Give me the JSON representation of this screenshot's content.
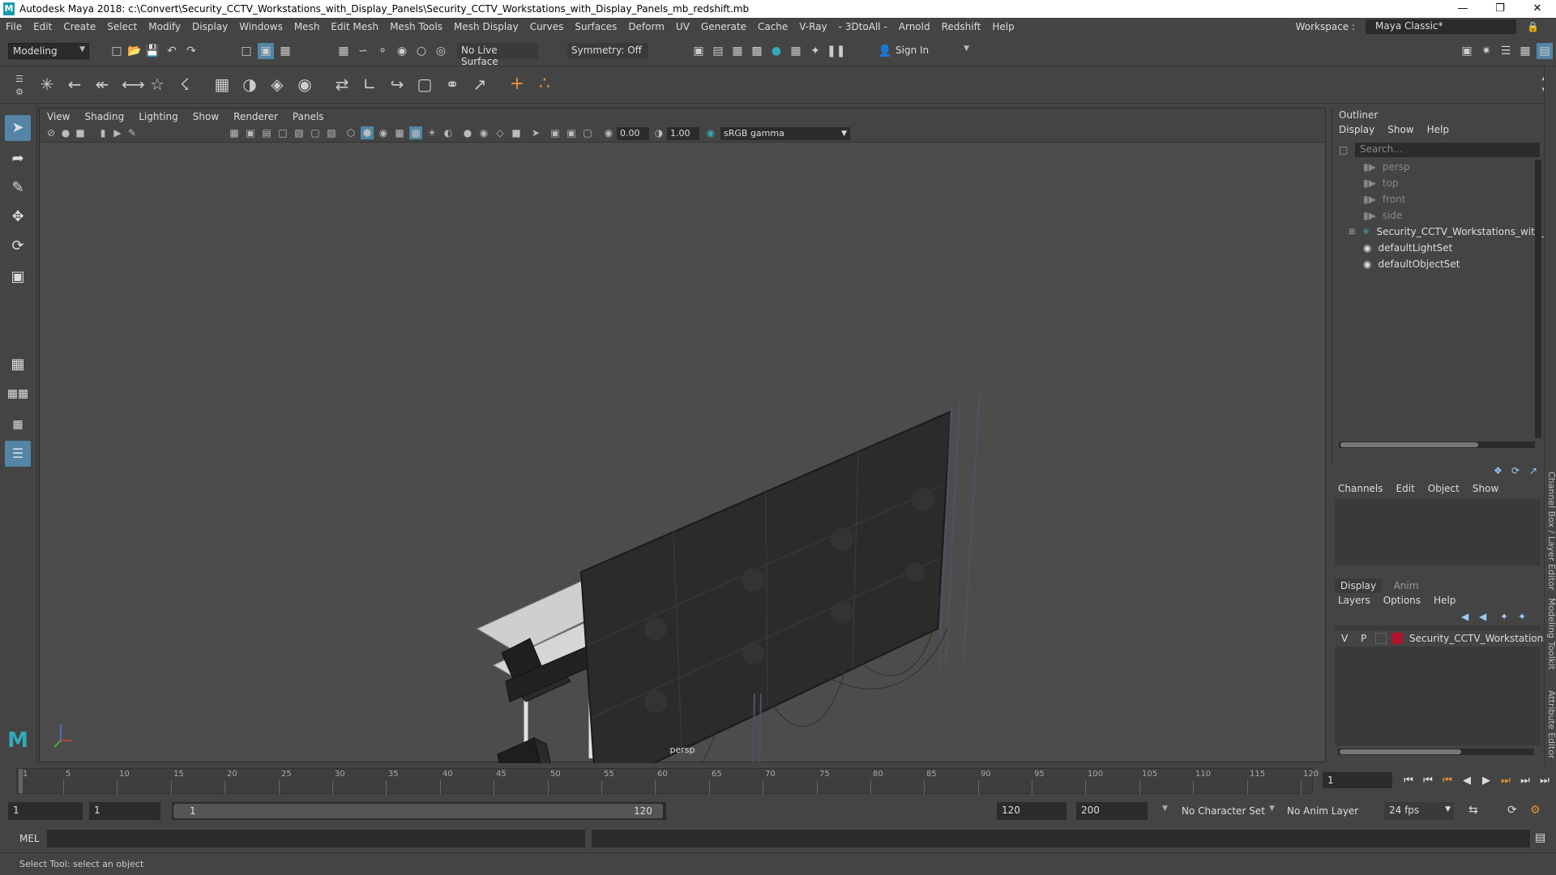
{
  "window": {
    "title": "Autodesk Maya 2018: c:\\Convert\\Security_CCTV_Workstations_with_Display_Panels\\Security_CCTV_Workstations_with_Display_Panels_mb_redshift.mb"
  },
  "menubar": {
    "items": [
      "File",
      "Edit",
      "Create",
      "Select",
      "Modify",
      "Display",
      "Windows",
      "Mesh",
      "Edit Mesh",
      "Mesh Tools",
      "Mesh Display",
      "Curves",
      "Surfaces",
      "Deform",
      "UV",
      "Generate",
      "Cache",
      "V-Ray",
      "- 3DtoAll -",
      "Arnold",
      "Redshift",
      "Help"
    ],
    "workspace_label": "Workspace :",
    "workspace_value": "Maya Classic*"
  },
  "statusline": {
    "mode": "Modeling",
    "live_surface": "No Live Surface",
    "symmetry": "Symmetry: Off",
    "sign_in": "Sign In"
  },
  "viewport": {
    "menu": [
      "View",
      "Shading",
      "Lighting",
      "Show",
      "Renderer",
      "Panels"
    ],
    "exposure": "0.00",
    "gamma": "1.00",
    "colorspace": "sRGB gamma",
    "camera_label": "persp"
  },
  "outliner": {
    "title": "Outliner",
    "menu": [
      "Display",
      "Show",
      "Help"
    ],
    "search_placeholder": "Search...",
    "items": [
      {
        "label": "persp",
        "icon": "camera-icon",
        "dim": true
      },
      {
        "label": "top",
        "icon": "camera-icon",
        "dim": true
      },
      {
        "label": "front",
        "icon": "camera-icon",
        "dim": true
      },
      {
        "label": "side",
        "icon": "camera-icon",
        "dim": true
      },
      {
        "label": "Security_CCTV_Workstations_with_Displ",
        "icon": "transform-icon",
        "dim": false
      },
      {
        "label": "defaultLightSet",
        "icon": "set-icon",
        "dim": false
      },
      {
        "label": "defaultObjectSet",
        "icon": "set-icon",
        "dim": false
      }
    ]
  },
  "channelbox": {
    "menu": [
      "Channels",
      "Edit",
      "Object",
      "Show"
    ]
  },
  "layereditor": {
    "tabs": [
      "Display",
      "Anim"
    ],
    "menu": [
      "Layers",
      "Options",
      "Help"
    ],
    "layer": {
      "v": "V",
      "p": "P",
      "name": "Security_CCTV_Workstations_v",
      "color": "#b0152f"
    }
  },
  "side_tabs": [
    "Channel Box / Layer Editor",
    "Modeling Toolkit",
    "Attribute Editor"
  ],
  "timeline": {
    "ticks": [
      1,
      5,
      10,
      15,
      20,
      25,
      30,
      35,
      40,
      45,
      50,
      55,
      60,
      65,
      70,
      75,
      80,
      85,
      90,
      95,
      100,
      105,
      110,
      115,
      120
    ],
    "current_frame": "1"
  },
  "range": {
    "start": "1",
    "start2": "1",
    "slider_start": "1",
    "slider_end": "120",
    "end": "120",
    "max": "200",
    "character_set": "No Character Set",
    "anim_layer": "No Anim Layer",
    "fps": "24 fps"
  },
  "command": {
    "label": "MEL"
  },
  "help": {
    "text": "Select Tool: select an object"
  }
}
